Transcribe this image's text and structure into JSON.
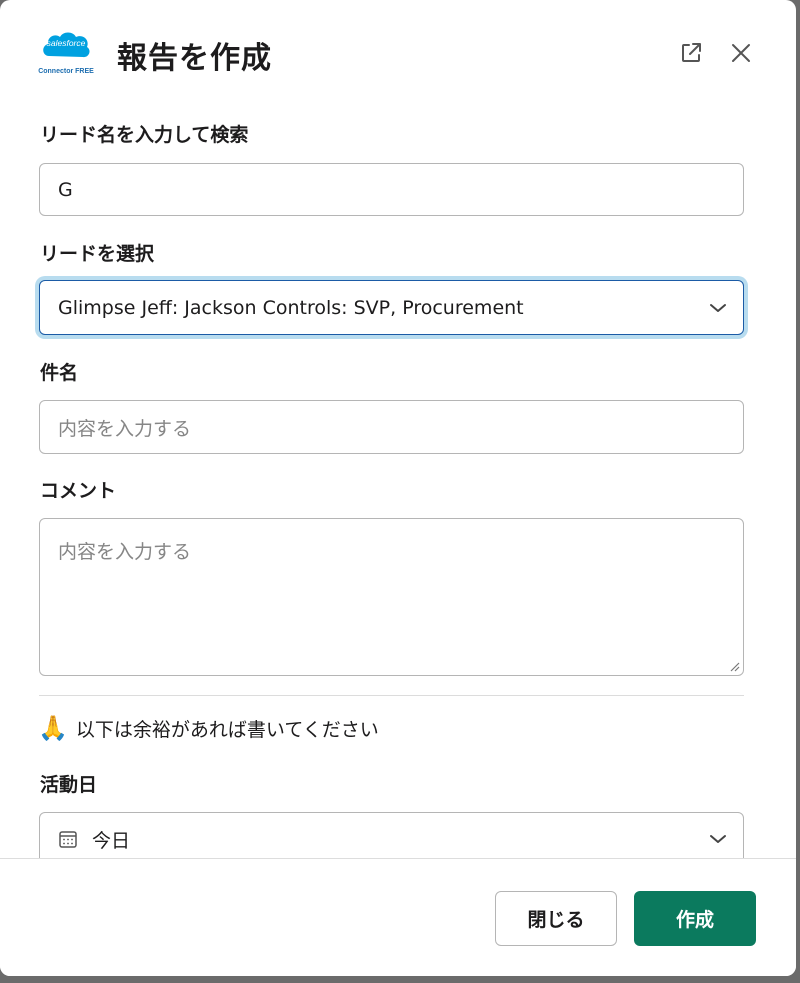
{
  "header": {
    "logo_text": "salesforce",
    "logo_caption": "Connector FREE",
    "title": "報告を作成"
  },
  "form": {
    "lead_search": {
      "label": "リード名を入力して検索",
      "value": "G"
    },
    "lead_select": {
      "label": "リードを選択",
      "value": "Glimpse Jeff: Jackson Controls: SVP, Procurement"
    },
    "subject": {
      "label": "件名",
      "placeholder": "内容を入力する"
    },
    "comment": {
      "label": "コメント",
      "placeholder": "内容を入力する"
    },
    "optional_note": {
      "emoji": "🙏",
      "text": "以下は余裕があれば書いてください"
    },
    "activity_date": {
      "label": "活動日",
      "value": "今日"
    }
  },
  "footer": {
    "close_label": "閉じる",
    "create_label": "作成"
  },
  "colors": {
    "primary": "#0b7a5e",
    "focus_border": "#1b5ba6",
    "focus_ring": "#b8dcef",
    "salesforce_blue": "#00a1e0"
  }
}
